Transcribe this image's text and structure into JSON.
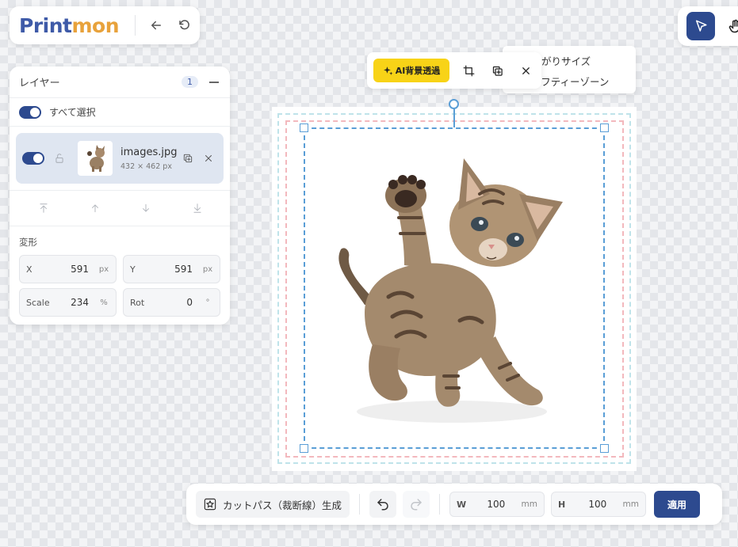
{
  "brand": {
    "part1": "Print",
    "part2": "mon",
    "primary_color": "#3e5aa8",
    "accent_color": "#e8a23b"
  },
  "header": {
    "back_icon": "arrow-left-icon",
    "reset_icon": "rotate-ccw-icon"
  },
  "tools": {
    "active": "select-pointer-icon",
    "other": "hand-pan-icon"
  },
  "layers": {
    "title": "レイヤー",
    "count": "1",
    "select_all_label": "すべて選択",
    "items": [
      {
        "name": "images.jpg",
        "size": "432 × 462 px",
        "visible": true,
        "locked": false
      }
    ]
  },
  "transform": {
    "title": "変形",
    "fields": [
      {
        "label": "X",
        "value": "591",
        "unit": "px"
      },
      {
        "label": "Y",
        "value": "591",
        "unit": "px"
      },
      {
        "label": "Scale",
        "value": "234",
        "unit": "%"
      },
      {
        "label": "Rot",
        "value": "0",
        "unit": "°"
      }
    ]
  },
  "float_toolbar": {
    "ai_label": "AI背景透過"
  },
  "legend": {
    "rows": [
      {
        "label": "仕上がりサイズ",
        "color": "#f3b8bd"
      },
      {
        "label": "セーフティーゾーン",
        "color": "#bfe3ea"
      }
    ]
  },
  "bottom": {
    "cut_label": "カットパス（裁断線）生成",
    "width": {
      "label": "W",
      "value": "100",
      "unit": "mm"
    },
    "height": {
      "label": "H",
      "value": "100",
      "unit": "mm"
    },
    "apply_label": "適用"
  }
}
